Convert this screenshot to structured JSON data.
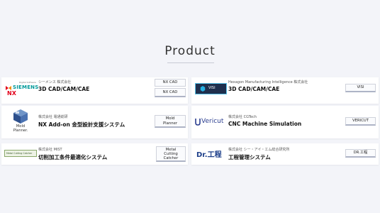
{
  "section": {
    "title": "Product"
  },
  "cards": [
    {
      "logo_brand": "SIEMENS",
      "logo_sub": "NX",
      "logo_caption": "Digital Software",
      "company": "シーメンス 株式会社",
      "product": "3D CAD/CAM/CAE",
      "tags": [
        "NX CAD",
        "NX CAD"
      ]
    },
    {
      "logo_badge": "VISI",
      "company": "Hexagon Manufacturing Intelligence 株式会社",
      "product": "3D CAD/CAM/CAE",
      "tags": [
        "VISI"
      ]
    },
    {
      "logo_text": "Mold\nPlanner.",
      "company": "株式会社 電通総研",
      "product": "NX Add-on 金型設計支援システム",
      "tags": [
        "Mold\nPlanner"
      ]
    },
    {
      "logo_text": "Vericut",
      "company": "株式会社 CGTech",
      "product": "CNC Machine Simulation",
      "tags": [
        "VERICUT"
      ]
    },
    {
      "logo_text": "Metal Cutting Catcher",
      "company": "株式会社 MIST",
      "product": "切削加工条件最適化システム",
      "tags": [
        "Metal\nCutting\nCatcher"
      ]
    },
    {
      "logo_text": "Dr.工程",
      "company": "株式会社 シー・アイ・エム総合研究所",
      "product": "工程管理システム",
      "tags": [
        "DR.工程"
      ]
    }
  ],
  "colors": {
    "background": "#f3f4f9",
    "siemens_teal": "#009999",
    "nx_red": "#e2001a",
    "vericut_blue": "#2a3d8f",
    "dr_blue": "#1d3f8a"
  }
}
